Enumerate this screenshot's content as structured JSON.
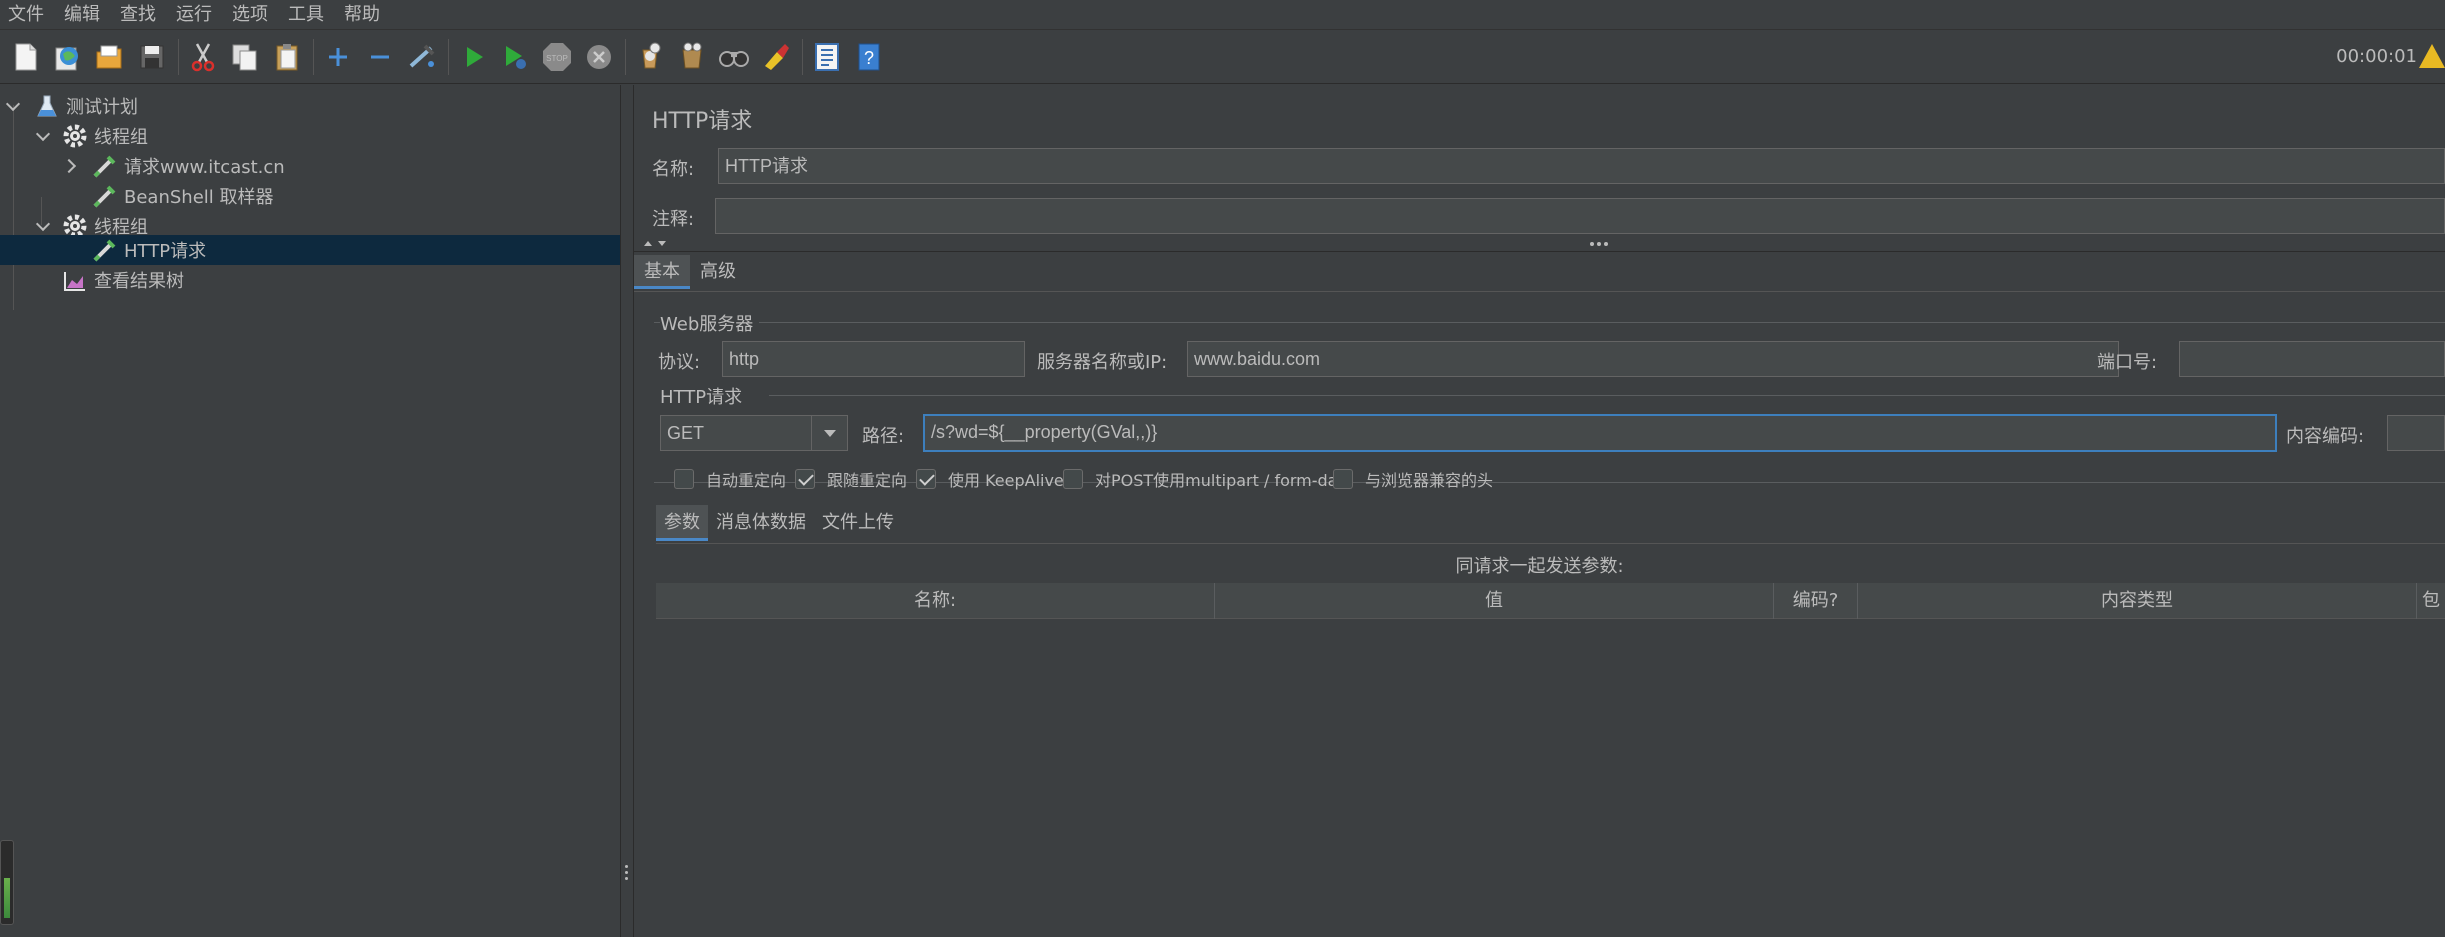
{
  "menubar": {
    "items": [
      "文件",
      "编辑",
      "查找",
      "运行",
      "选项",
      "工具",
      "帮助"
    ]
  },
  "toolbar": {
    "timer": "00:00:01",
    "buttons": [
      "new-icon",
      "templates-icon",
      "open-icon",
      "save-icon",
      "cut-icon",
      "copy-icon",
      "paste-icon",
      "expand-icon",
      "collapse-icon",
      "toggle-icon",
      "start-icon",
      "start-no-pause-icon",
      "stop-icon",
      "shutdown-icon",
      "clear-icon",
      "clear-all-icon",
      "search-icon",
      "reset-search-icon",
      "function-helper-icon",
      "help-icon"
    ]
  },
  "tree": {
    "items": [
      {
        "label": "测试计划",
        "icon": "test-plan-icon"
      },
      {
        "label": "线程组",
        "icon": "thread-group-icon"
      },
      {
        "label": "请求www.itcast.cn",
        "icon": "sampler-icon"
      },
      {
        "label": "BeanShell 取样器",
        "icon": "sampler-icon"
      },
      {
        "label": "线程组",
        "icon": "thread-group-icon"
      },
      {
        "label": "HTTP请求",
        "icon": "sampler-icon"
      },
      {
        "label": "查看结果树",
        "icon": "listener-icon"
      }
    ]
  },
  "panel": {
    "title": "HTTP请求",
    "name_label": "名称:",
    "name_value": "HTTP请求",
    "comment_label": "注释:",
    "comment_value": "",
    "tabs": [
      "基本",
      "高级"
    ],
    "web_server": {
      "group_title": "Web服务器",
      "protocol_label": "协议:",
      "protocol_value": "http",
      "server_label": "服务器名称或IP:",
      "server_value": "www.baidu.com",
      "port_label": "端口号:",
      "port_value": ""
    },
    "http_request": {
      "group_title": "HTTP请求",
      "method_value": "GET",
      "path_label": "路径:",
      "path_value": "/s?wd=${__property(GVal,,)}",
      "encoding_label": "内容编码:",
      "encoding_value": ""
    },
    "checkboxes": [
      {
        "label": "自动重定向",
        "checked": false
      },
      {
        "label": "跟随重定向",
        "checked": true
      },
      {
        "label": "使用 KeepAlive",
        "checked": true
      },
      {
        "label": "对POST使用multipart / form-data",
        "checked": false
      },
      {
        "label": "与浏览器兼容的头",
        "checked": false
      }
    ],
    "subtabs": [
      "参数",
      "消息体数据",
      "文件上传"
    ],
    "table": {
      "caption": "同请求一起发送参数:",
      "columns": [
        "名称:",
        "值",
        "编码?",
        "内容类型",
        "包"
      ]
    }
  }
}
